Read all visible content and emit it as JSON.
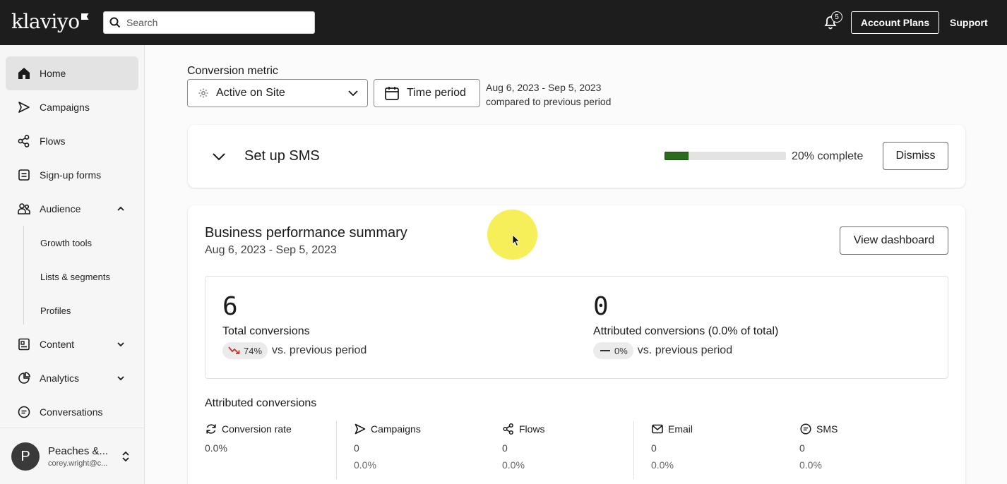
{
  "topbar": {
    "logo": "klaviyo",
    "search_placeholder": "Search",
    "notification_count": "5",
    "account_plans": "Account Plans",
    "support": "Support"
  },
  "sidebar": {
    "items": [
      {
        "label": "Home",
        "icon": "home-icon"
      },
      {
        "label": "Campaigns",
        "icon": "send-icon"
      },
      {
        "label": "Flows",
        "icon": "flows-icon"
      },
      {
        "label": "Sign-up forms",
        "icon": "form-icon"
      },
      {
        "label": "Audience",
        "icon": "audience-icon"
      },
      {
        "label": "Content",
        "icon": "content-icon"
      },
      {
        "label": "Analytics",
        "icon": "analytics-icon"
      },
      {
        "label": "Conversations",
        "icon": "chat-icon"
      }
    ],
    "audience_sub": [
      "Growth tools",
      "Lists & segments",
      "Profiles"
    ],
    "account": {
      "initial": "P",
      "name": "Peaches &...",
      "email": "corey.wright@c..."
    }
  },
  "filters": {
    "metric_label": "Conversion metric",
    "metric_value": "Active on Site",
    "time_period": "Time period",
    "date_range": "Aug 6, 2023 - Sep 5, 2023",
    "comparison": "compared to previous period"
  },
  "sms_setup": {
    "title": "Set up SMS",
    "progress": 0.2,
    "progress_label": "20% complete",
    "dismiss": "Dismiss",
    "progress_color": "#2a6b1f"
  },
  "performance": {
    "title": "Business performance summary",
    "date": "Aug 6, 2023 - Sep 5, 2023",
    "view_dashboard": "View dashboard",
    "total": {
      "value": "6",
      "label": "Total conversions",
      "delta": "74%",
      "delta_suffix": "vs. previous period"
    },
    "attributed": {
      "value": "0",
      "label": "Attributed conversions (0.0% of total)",
      "delta": "0%",
      "delta_suffix": "vs. previous period"
    },
    "attributed_title": "Attributed conversions",
    "columns": [
      {
        "label": "Conversion rate",
        "icon": "refresh-icon",
        "value": "0.0%",
        "pct": ""
      },
      {
        "label": "Campaigns",
        "icon": "send-icon",
        "value": "0",
        "pct": "0.0%"
      },
      {
        "label": "Flows",
        "icon": "flows-icon",
        "value": "0",
        "pct": "0.0%"
      },
      {
        "label": "Email",
        "icon": "email-icon",
        "value": "0",
        "pct": "0.0%"
      },
      {
        "label": "SMS",
        "icon": "sms-icon",
        "value": "0",
        "pct": "0.0%"
      }
    ]
  }
}
